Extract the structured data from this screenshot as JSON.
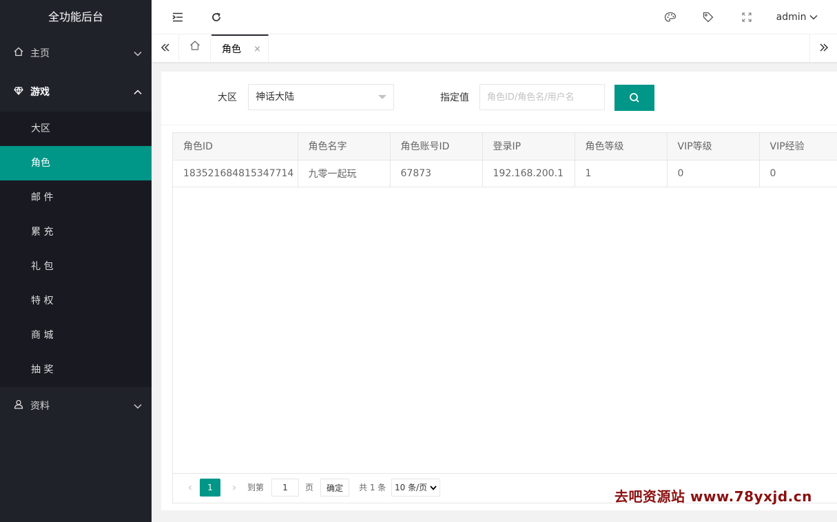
{
  "app": {
    "title": "全功能后台"
  },
  "sidebar": {
    "groups": [
      {
        "label": "主页",
        "icon": "home-icon",
        "chevron": "down"
      },
      {
        "label": "游戏",
        "icon": "diamond-icon",
        "chevron": "up"
      },
      {
        "label": "资料",
        "icon": "user-icon",
        "chevron": "down"
      }
    ],
    "sub_items": [
      "大区",
      "角色",
      "邮 件",
      "累 充",
      "礼 包",
      "特 权",
      "商 城",
      "抽 奖"
    ],
    "active_item": "角色"
  },
  "header": {
    "icons": [
      "menu-fold-icon",
      "refresh-icon",
      "palette-icon",
      "tag-icon",
      "fullscreen-icon"
    ],
    "user": "admin"
  },
  "tabs": {
    "items": [
      {
        "label": "角色",
        "close": "×"
      }
    ]
  },
  "search": {
    "region_label": "大区",
    "region_value": "神话大陆",
    "value_label": "指定值",
    "value_placeholder": "角色ID/角色名/用户名"
  },
  "table": {
    "columns": [
      "角色ID",
      "角色名字",
      "角色账号ID",
      "登录IP",
      "角色等级",
      "VIP等级",
      "VIP经验"
    ],
    "rows": [
      [
        "183521684815347714",
        "九零一起玩",
        "67873",
        "192.168.200.1",
        "1",
        "0",
        "0"
      ]
    ]
  },
  "pager": {
    "current": "1",
    "goto_label": "到第",
    "goto_value": "1",
    "page_label": "页",
    "confirm": "确定",
    "total": "共 1 条",
    "page_size": "10 条/页"
  },
  "watermark": "去吧资源站 www.78yxjd.cn",
  "colors": {
    "accent": "#009688",
    "sidebar_bg": "#20222a",
    "submenu_bg": "#191a21"
  }
}
